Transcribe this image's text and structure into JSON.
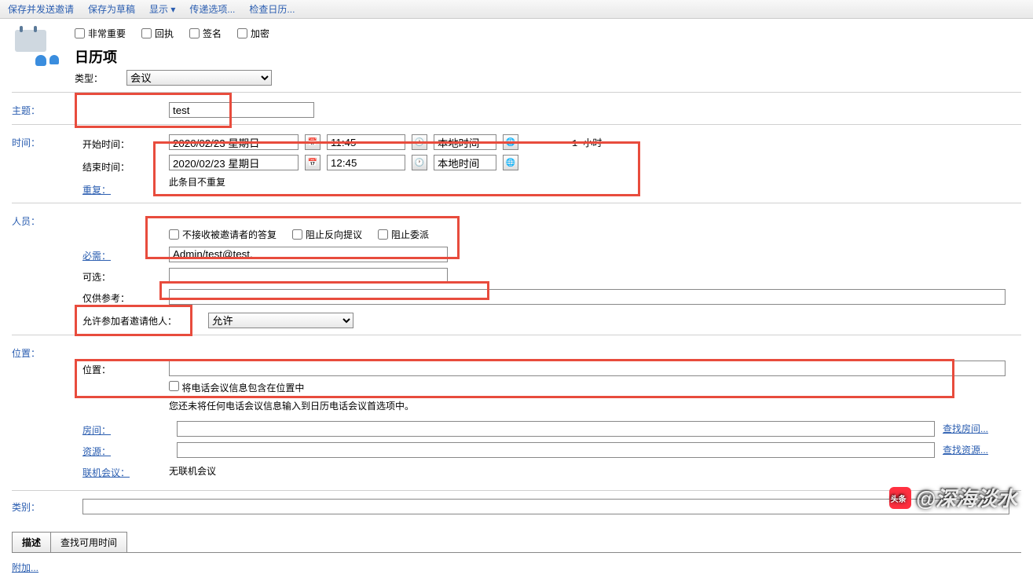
{
  "toolbar": {
    "save_send": "保存并发送邀请",
    "save_draft": "保存为草稿",
    "display": "显示 ▾",
    "delivery": "传递选项...",
    "check_calendar": "检查日历..."
  },
  "checkboxes": {
    "very_important": "非常重要",
    "receipt": "回执",
    "sign": "签名",
    "encrypt": "加密"
  },
  "header": {
    "title": "日历项",
    "type_label": "类型：",
    "type_value": "会议"
  },
  "subject": {
    "label": "主题：",
    "value": "test"
  },
  "time": {
    "section_label": "时间：",
    "start_label": "开始时间：",
    "end_label": "结束时间：",
    "repeat_label": "重复：",
    "start_date": "2020/02/23 星期日",
    "start_time": "11:45",
    "end_date": "2020/02/23 星期日",
    "end_time": "12:45",
    "timezone": "本地时间",
    "duration": "1 小时",
    "repeat_text": "此条目不重复"
  },
  "people": {
    "section_label": "人员：",
    "no_replies_cb": "不接收被邀请者的答复",
    "prevent_counter_cb": "阻止反向提议",
    "prevent_delegate_cb": "阻止委派",
    "required_label": "必需：",
    "required_value": "Admin/test@test,",
    "optional_label": "可选：",
    "optional_value": "",
    "fyi_label": "仅供参考：",
    "allow_label": "允许参加者邀请他人：",
    "allow_value": "允许"
  },
  "location": {
    "section_label": "位置：",
    "location_label": "位置：",
    "location_value": "",
    "include_phone_cb": "将电话会议信息包含在位置中",
    "phone_note": "您还未将任何电话会议信息输入到日历电话会议首选项中。",
    "rooms_label": "房间：",
    "find_rooms": "查找房间...",
    "resources_label": "资源：",
    "find_resources": "查找资源...",
    "online_label": "联机会议：",
    "online_text": "无联机会议"
  },
  "category": {
    "label": "类别：",
    "value": ""
  },
  "tabs": {
    "description": "描述",
    "find_available": "查找可用时间"
  },
  "description": {
    "attach": "附加..."
  },
  "watermark": "@深海淡水"
}
